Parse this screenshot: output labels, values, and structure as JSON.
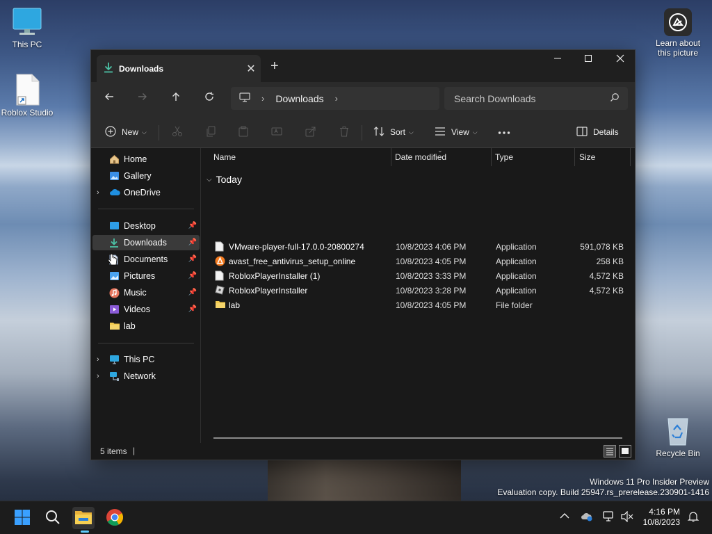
{
  "desktop": {
    "icons": [
      {
        "label": "This PC"
      },
      {
        "label": "Roblox Studio"
      },
      {
        "label": "Recycle Bin"
      }
    ],
    "learn_label_1": "Learn about",
    "learn_label_2": "this picture",
    "watermark_line1": "Windows 11 Pro Insider Preview",
    "watermark_line2": "Evaluation copy. Build 25947.rs_prerelease.230901-1416"
  },
  "window": {
    "tab_title": "Downloads",
    "address": {
      "segment": "Downloads"
    },
    "search_placeholder": "Search Downloads",
    "toolbar": {
      "new_label": "New",
      "sort_label": "Sort",
      "view_label": "View",
      "details_label": "Details"
    },
    "nav": {
      "top": [
        {
          "label": "Home"
        },
        {
          "label": "Gallery"
        },
        {
          "label": "OneDrive"
        }
      ],
      "quick": [
        {
          "label": "Desktop"
        },
        {
          "label": "Downloads"
        },
        {
          "label": "Documents"
        },
        {
          "label": "Pictures"
        },
        {
          "label": "Music"
        },
        {
          "label": "Videos"
        },
        {
          "label": "lab"
        }
      ],
      "bottom": [
        {
          "label": "This PC"
        },
        {
          "label": "Network"
        }
      ]
    },
    "columns": {
      "name": "Name",
      "date": "Date modified",
      "type": "Type",
      "size": "Size"
    },
    "group_label": "Today",
    "files": [
      {
        "name": "VMware-player-full-17.0.0-20800274",
        "date": "10/8/2023 4:06 PM",
        "type": "Application",
        "size": "591,078 KB",
        "icon": "file-icon"
      },
      {
        "name": "avast_free_antivirus_setup_online",
        "date": "10/8/2023 4:05 PM",
        "type": "Application",
        "size": "258 KB",
        "icon": "avast-icon"
      },
      {
        "name": "RobloxPlayerInstaller (1)",
        "date": "10/8/2023 3:33 PM",
        "type": "Application",
        "size": "4,572 KB",
        "icon": "file-icon"
      },
      {
        "name": "RobloxPlayerInstaller",
        "date": "10/8/2023 3:28 PM",
        "type": "Application",
        "size": "4,572 KB",
        "icon": "roblox-icon"
      },
      {
        "name": "lab",
        "date": "10/8/2023 4:05 PM",
        "type": "File folder",
        "size": "",
        "icon": "folder-icon"
      }
    ],
    "status_items": "5 items"
  },
  "taskbar": {
    "time": "4:16 PM",
    "date": "10/8/2023"
  },
  "colors": {
    "accent": "#60cdff",
    "window_bg": "#191919",
    "bar_bg": "#2b2b2b"
  }
}
